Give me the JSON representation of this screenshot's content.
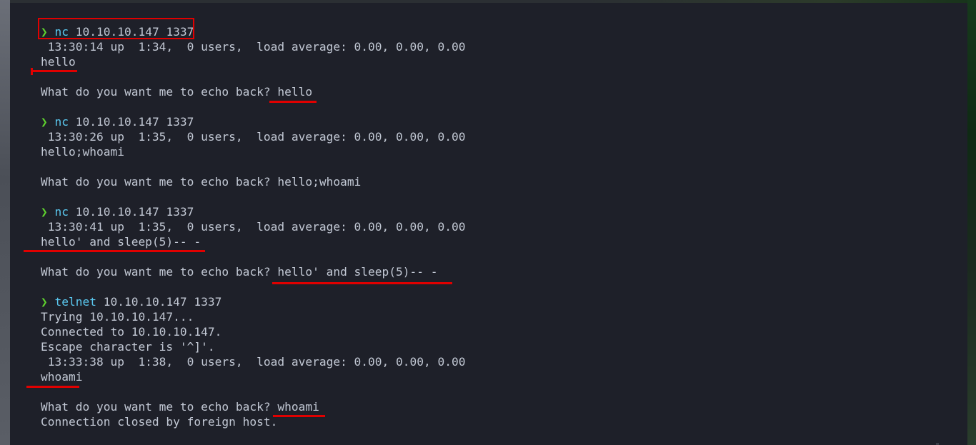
{
  "terminal": {
    "prompt_symbol": "❯",
    "sessions": [
      {
        "command": "nc",
        "args": " 10.10.10.147 1337",
        "uptime": " 13:30:14 up  1:34,  0 users,  load average: 0.00, 0.00, 0.00",
        "input": "hello",
        "echo_prefix": "What do you want me to echo back? ",
        "echo": "hello"
      },
      {
        "command": "nc",
        "args": " 10.10.10.147 1337",
        "uptime": " 13:30:26 up  1:35,  0 users,  load average: 0.00, 0.00, 0.00",
        "input": "hello;whoami",
        "echo_prefix": "What do you want me to echo back? ",
        "echo": "hello;whoami"
      },
      {
        "command": "nc",
        "args": " 10.10.10.147 1337",
        "uptime": " 13:30:41 up  1:35,  0 users,  load average: 0.00, 0.00, 0.00",
        "input": "hello' and sleep(5)-- -",
        "echo_prefix": "What do you want me to echo back? ",
        "echo": "hello' and sleep(5)-- -"
      },
      {
        "command": "telnet",
        "args": " 10.10.10.147 1337",
        "trying": "Trying 10.10.10.147...",
        "connected": "Connected to 10.10.10.147.",
        "escape": "Escape character is '^]'.",
        "uptime": " 13:33:38 up  1:38,  0 users,  load average: 0.00, 0.00, 0.00",
        "input": "whoami",
        "echo_prefix": "What do you want me to echo back? ",
        "echo": "whoami",
        "closed": "Connection closed by foreign host."
      }
    ]
  },
  "colors": {
    "background": "#1e2029",
    "text": "#c2c8d4",
    "prompt": "#5fd12e",
    "command": "#5ac8f0",
    "annotation": "#e00000"
  }
}
